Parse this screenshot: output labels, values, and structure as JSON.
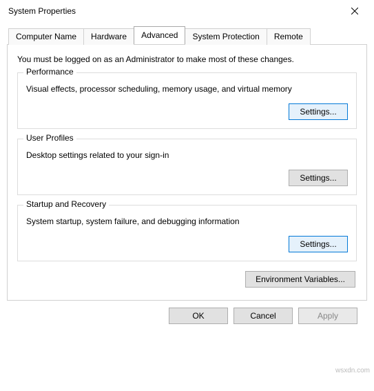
{
  "window": {
    "title": "System Properties"
  },
  "tabs": {
    "t0": "Computer Name",
    "t1": "Hardware",
    "t2": "Advanced",
    "t3": "System Protection",
    "t4": "Remote",
    "activeIndex": 2
  },
  "advanced": {
    "intro": "You must be logged on as an Administrator to make most of these changes.",
    "performance": {
      "legend": "Performance",
      "desc": "Visual effects, processor scheduling, memory usage, and virtual memory",
      "button": "Settings..."
    },
    "userProfiles": {
      "legend": "User Profiles",
      "desc": "Desktop settings related to your sign-in",
      "button": "Settings..."
    },
    "startupRecovery": {
      "legend": "Startup and Recovery",
      "desc": "System startup, system failure, and debugging information",
      "button": "Settings..."
    },
    "envVars": "Environment Variables..."
  },
  "buttons": {
    "ok": "OK",
    "cancel": "Cancel",
    "apply": "Apply"
  },
  "watermark": "wsxdn.com"
}
